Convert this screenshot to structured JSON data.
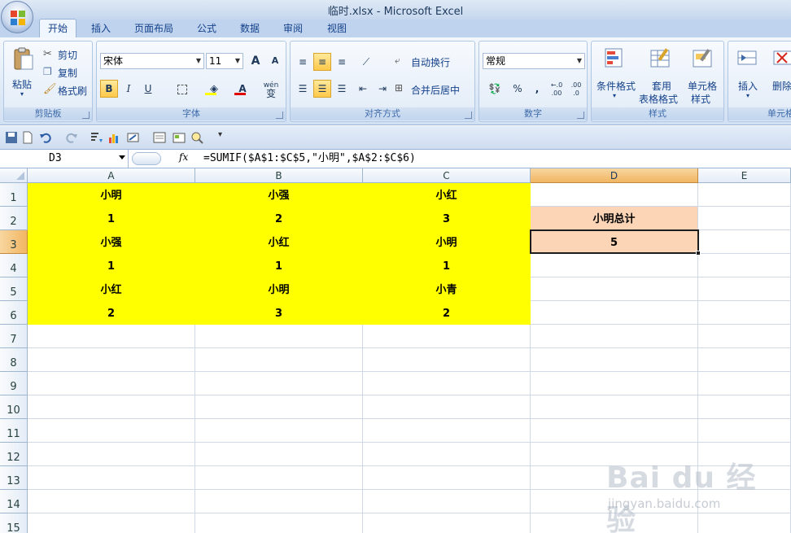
{
  "window": {
    "title": "临时.xlsx - Microsoft Excel"
  },
  "tabs": [
    "开始",
    "插入",
    "页面布局",
    "公式",
    "数据",
    "审阅",
    "视图"
  ],
  "ribbon": {
    "clipboard": {
      "label": "剪贴板",
      "paste": "粘贴",
      "cut": "剪切",
      "copy": "复制",
      "format_painter": "格式刷"
    },
    "font": {
      "label": "字体",
      "font_name": "宋体",
      "font_size": "11",
      "bold": "B",
      "italic": "I",
      "underline": "U",
      "grow": "A",
      "shrink": "A",
      "font_color": "A",
      "wen": "wén",
      "phonetic": "变"
    },
    "alignment": {
      "label": "对齐方式",
      "wrap": "自动换行",
      "merge": "合并后居中"
    },
    "number": {
      "label": "数字",
      "format": "常规",
      "percent": "%",
      "comma": ",",
      "inc": ".00",
      "inc_top": "←.0",
      "dec": ".0",
      "dec_top": ".00"
    },
    "styles": {
      "label": "样式",
      "conditional": "条件格式",
      "table_a": "套用",
      "table_b": "表格格式",
      "cell_a": "单元格",
      "cell_b": "样式"
    },
    "cells": {
      "label": "单元格",
      "insert": "插入",
      "delete": "删除"
    }
  },
  "formula_bar": {
    "name_box": "D3",
    "fx": "fx",
    "formula": "=SUMIF($A$1:$C$5,\"小明\",$A$2:$C$6)"
  },
  "columns": [
    "A",
    "B",
    "C",
    "D",
    "E"
  ],
  "rows": [
    "1",
    "2",
    "3",
    "4",
    "5",
    "6",
    "7",
    "8",
    "9",
    "10",
    "11",
    "12",
    "13",
    "14",
    "15"
  ],
  "cells": {
    "r1": [
      "小明",
      "小强",
      "小红"
    ],
    "r2": [
      "1",
      "2",
      "3",
      "小明总计"
    ],
    "r3": [
      "小强",
      "小红",
      "小明",
      "5"
    ],
    "r4": [
      "1",
      "1",
      "1"
    ],
    "r5": [
      "小红",
      "小明",
      "小青"
    ],
    "r6": [
      "2",
      "3",
      "2"
    ]
  },
  "watermark": {
    "logo": "Bai du 经验",
    "url": "jingyan.baidu.com"
  },
  "colors": {
    "highlight": "#ffff00",
    "peach": "#fbd5b5",
    "selected_header": "#f1b662"
  }
}
